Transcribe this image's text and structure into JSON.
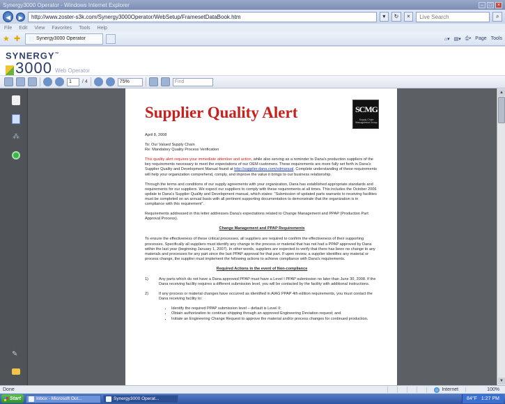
{
  "window": {
    "title": "Synergy3000 Operator - Windows Internet Explorer"
  },
  "address": {
    "url": "http://www.zoster-s3k.com/Synergy3000Operator/WebSetup/FramesetDataBook.htm",
    "search_placeholder": "Live Search"
  },
  "menu": {
    "items": [
      "File",
      "Edit",
      "View",
      "Favorites",
      "Tools",
      "Help"
    ]
  },
  "tabs": {
    "active_label": "Synergy3000 Operator"
  },
  "commands": {
    "page_label": "Page",
    "tools_label": "Tools"
  },
  "brand": {
    "name": "SYNERGY",
    "tm": "™",
    "number": "3000",
    "subtitle": "Web Operator"
  },
  "pdf": {
    "page_current": "1",
    "page_total": "/ 4",
    "zoom": "75%",
    "find_placeholder": "Find"
  },
  "document": {
    "title": "Supplier Quality Alert",
    "seal_big": "SCMG",
    "seal_small": "Supply Chain Management Group",
    "date": "April 8, 2008",
    "to": "To: Our Valued Supply Chain",
    "re": "Re: Mandatory Quality Process Verification",
    "p1_red": "This quality alert requires your immediate attention and action,",
    "p1_text_a": " while also serving as a reminder to Dana's production suppliers of the key requirements necessary to meet the expectations of our OEM customers. These requirements are more fully set forth in Dana's Supplier Quality and Development Manual found at ",
    "p1_link": "http://supplier.dana.com/sdmanual",
    "p1_text_b": ". Complete understanding of these requirements will help your organization comprehend, comply, and improve the value it brings to our business relationship.",
    "p2": "Through the terms and conditions of our supply agreements with your organization, Dana has established appropriate standards and requirements for our suppliers. We expect our suppliers to comply with these requirements at all times. This includes the October 2006 update to Dana's Supplier Quality and Development manual, which states: \"Submission of updated parts warrants to receiving facilities must be completed on an annual basis with all pertinent supporting documentation to demonstrate that the organization is in compliance with this requirement\".",
    "p3": "Requirements addressed in this letter addresses Dana's expectations related to Change Management and PPAP (Production Part Approval Process).",
    "heading1": "Change Management and PPAP Requirements",
    "p4": "To ensure the effectiveness of these critical processes, all suppliers are required to confirm the effectiveness of their supporting processes. Specifically all suppliers must identify any change to the process or material that has not had a PPAP approved by Dana within the last year (beginning January 1, 2007). In other words, suppliers are expected to verify that there has been no change to any materials and processes for any part since the last PPAP approval for that part. If upon review, a supplier identifies any material or process change, the supplier must implement the following actions to achieve compliance with Dana's requirements.",
    "heading2": "Required Actions in the event of Non-compliance",
    "item1_num": "1)",
    "item1": "Any parts which do not have a Dana approved PPAP must have a Level I PPAP submission no later than June 30, 2008. If the Dana receiving facility requires a different submission level, you will be contacted by the facility with additional instructions.",
    "item2_num": "2)",
    "item2": "If any process or material changes have occurred as identified in AIAG PPAP 4th edition requirements, you must contact the Dana receiving facility to:",
    "bullets": [
      "Identify the required PPAP submission level – default is Level II;",
      "Obtain authorization to continue shipping through an approved Engineering Deviation request; and",
      "Initiate an Engineering Change Request to approve the material and/or process changes for continued production."
    ]
  },
  "status": {
    "left": "Done",
    "zone": "Internet",
    "zoom": "100%"
  },
  "taskbar": {
    "start": "Start",
    "task1": "Inbox - Microsoft Out...",
    "task2": "Synergy3000 Operat...",
    "clock": "1:27 PM",
    "temp": "84°F"
  }
}
